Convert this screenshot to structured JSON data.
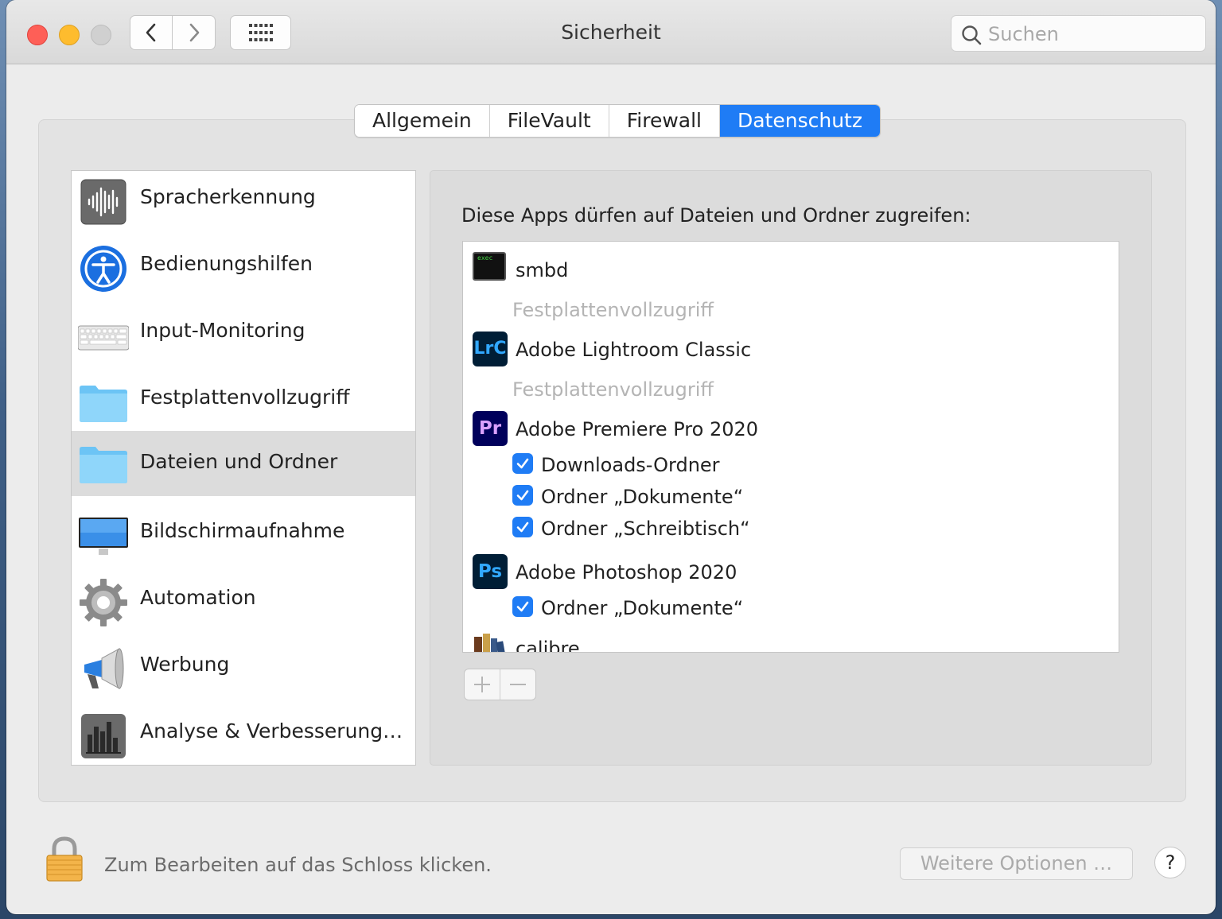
{
  "window": {
    "title": "Sicherheit"
  },
  "toolbar": {
    "back_icon": "chevron-left-icon",
    "forward_icon": "chevron-right-icon",
    "grid_icon": "grid-icon",
    "search_placeholder": "Suchen"
  },
  "tabs": [
    {
      "label": "Allgemein",
      "active": false
    },
    {
      "label": "FileVault",
      "active": false
    },
    {
      "label": "Firewall",
      "active": false
    },
    {
      "label": "Datenschutz",
      "active": true
    }
  ],
  "sidebar": {
    "items": [
      {
        "label": "Spracherkennung",
        "icon": "waveform-icon"
      },
      {
        "label": "Bedienungshilfen",
        "icon": "accessibility-icon"
      },
      {
        "label": "Input-Monitoring",
        "icon": "keyboard-icon"
      },
      {
        "label": "Festplattenvollzugriff",
        "icon": "folder-icon"
      },
      {
        "label": "Dateien und Ordner",
        "icon": "folder-icon",
        "selected": true
      },
      {
        "label": "Bildschirmaufnahme",
        "icon": "display-icon"
      },
      {
        "label": "Automation",
        "icon": "gear-icon"
      },
      {
        "label": "Werbung",
        "icon": "megaphone-icon"
      },
      {
        "label": "Analyse & Verbesserung…",
        "icon": "bar-chart-icon"
      }
    ]
  },
  "main": {
    "heading": "Diese Apps dürfen auf Dateien und Ordner zugreifen:",
    "apps": [
      {
        "name": "smbd",
        "icon": "terminal-icon",
        "icon_text": "exec",
        "note": "Festplattenvollzugriff"
      },
      {
        "name": "Adobe Lightroom Classic",
        "icon": "lightroom-icon",
        "icon_text": "LrC",
        "note": "Festplattenvollzugriff"
      },
      {
        "name": "Adobe Premiere Pro 2020",
        "icon": "premiere-icon",
        "icon_text": "Pr",
        "folders": [
          "Downloads-Ordner",
          "Ordner „Dokumente“",
          "Ordner „Schreibtisch“"
        ]
      },
      {
        "name": "Adobe Photoshop 2020",
        "icon": "photoshop-icon",
        "icon_text": "Ps",
        "folders": [
          "Ordner „Dokumente“"
        ]
      },
      {
        "name": "calibre",
        "icon": "books-icon"
      }
    ],
    "checkbox_states": [
      true,
      true,
      true,
      true
    ],
    "add_icon": "plus-icon",
    "remove_icon": "minus-icon"
  },
  "footer": {
    "lock_icon": "lock-icon",
    "lock_message": "Zum Bearbeiten auf das Schloss klicken.",
    "more_options": "Weitere Optionen …",
    "help": "?"
  },
  "colors": {
    "accent": "#1f7cf5",
    "selected_row": "#dcdcdc",
    "disabled_text": "#b4b4b4",
    "lightroom": "#001e36",
    "premiere": "#00005b",
    "photoshop": "#001e36"
  }
}
